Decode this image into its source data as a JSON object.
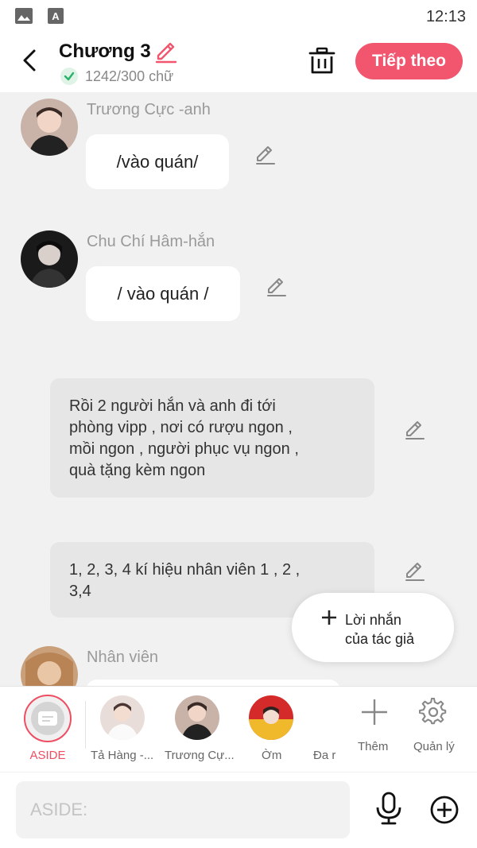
{
  "status_bar": {
    "time": "12:13",
    "icons": [
      "gallery-icon",
      "font-a-icon"
    ]
  },
  "header": {
    "title": "Chương 3",
    "word_count": "1242/300 chữ",
    "next_button": "Tiếp theo",
    "icons": [
      "back-arrow-icon",
      "edit-pencil-icon",
      "check-circle-icon",
      "trash-icon"
    ]
  },
  "colors": {
    "accent": "#f2566e",
    "check": "#29b36a",
    "bubble": "#ffffff",
    "narration": "#e6e6e6",
    "background": "#f1f1f1"
  },
  "messages": [
    {
      "type": "dialogue",
      "name": "Trương Cực -anh",
      "text": "/vào quán/"
    },
    {
      "type": "dialogue",
      "name": "Chu Chí Hâm-hắn",
      "text": "/ vào quán /"
    },
    {
      "type": "narration",
      "lines": [
        "Rồi 2 người hắn và anh đi tới",
        "phòng vipp , nơi có rượu ngon ,",
        "mồi ngon , người phục vụ ngon ,",
        "quà tặng kèm ngon"
      ]
    },
    {
      "type": "narration",
      "lines": [
        "1, 2, 3, 4  kí hiệu nhân viên 1 , 2 ,",
        "3,4"
      ]
    },
    {
      "type": "dialogue",
      "name": "Nhân viên",
      "text": ""
    }
  ],
  "author_note": {
    "line1": "Lời nhắn",
    "line2": "của tác giả"
  },
  "tray": {
    "items": [
      "ASIDE",
      "Tả Hàng -...",
      "Trương Cự...",
      "Ờm",
      "Đa r"
    ],
    "add_label": "Thêm",
    "manage_label": "Quản lý"
  },
  "input": {
    "placeholder": "ASIDE:"
  }
}
